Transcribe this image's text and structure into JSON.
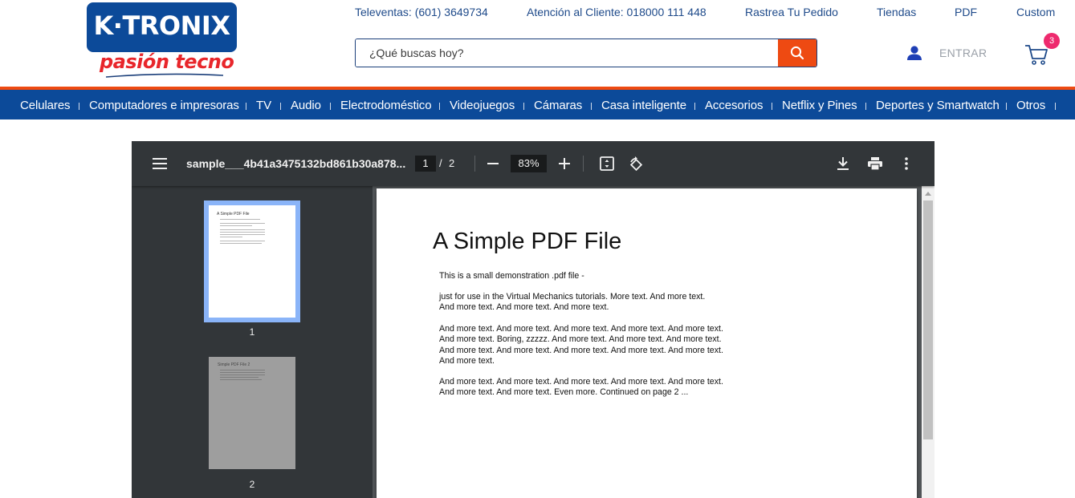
{
  "brand": {
    "name": "K·TRONIX",
    "tagline": "pasión tecno",
    "primary_color": "#0c4a99",
    "accent_color": "#ee4a12",
    "tagline_color": "#e8262b"
  },
  "top_links": [
    {
      "label": "Televentas: (601) 3649734"
    },
    {
      "label": "Atención al Cliente: 018000 111 448"
    },
    {
      "label": "Rastrea Tu Pedido"
    },
    {
      "label": "Tiendas"
    },
    {
      "label": "PDF"
    },
    {
      "label": "Custom"
    }
  ],
  "search": {
    "placeholder": "¿Qué buscas hoy?",
    "value": "",
    "icon": "search-icon"
  },
  "account": {
    "login_label": "ENTRAR",
    "icon": "user-icon"
  },
  "cart": {
    "count": "3",
    "icon": "cart-icon",
    "badge_color": "#ee2a6e"
  },
  "nav": [
    {
      "label": "Celulares"
    },
    {
      "label": "Computadores e impresoras"
    },
    {
      "label": "TV"
    },
    {
      "label": "Audio"
    },
    {
      "label": "Electrodoméstico"
    },
    {
      "label": "Videojuegos"
    },
    {
      "label": "Cámaras"
    },
    {
      "label": "Casa inteligente"
    },
    {
      "label": "Accesorios"
    },
    {
      "label": "Netflix y Pines"
    },
    {
      "label": "Deportes y Smartwatch"
    },
    {
      "label": "Otros"
    }
  ],
  "pdf_viewer": {
    "file_name": "sample___4b41a3475132bd861b30a878...",
    "current_page": "1",
    "page_separator": "/",
    "total_pages": "2",
    "zoom": "83%",
    "thumbnails": [
      {
        "number": "1",
        "title": "A Simple PDF File",
        "selected": true
      },
      {
        "number": "2",
        "title": "Simple PDF File 2",
        "selected": false
      }
    ],
    "page": {
      "title": "A Simple PDF File",
      "paragraphs": [
        "This is a small demonstration .pdf file -",
        "just for use in the Virtual Mechanics tutorials. More text. And more text. And more text. And more text. And more text.",
        "And more text. And more text. And more text. And more text. And more text. And more text. Boring, zzzzz. And more text. And more text. And more text. And more text. And more text. And more text. And more text. And more text. And more text.",
        "And more text. And more text. And more text. And more text. And more text. And more text. And more text. Even more. Continued on page 2 ..."
      ]
    }
  }
}
